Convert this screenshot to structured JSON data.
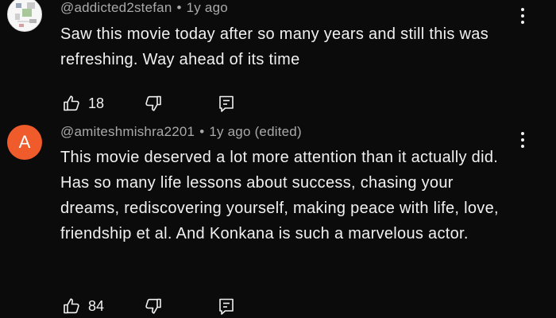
{
  "comments": [
    {
      "author": "@addicted2stefan",
      "time": "1y ago",
      "edited": "",
      "avatar_letter": "",
      "avatar_color": "#f6f6f6",
      "text": "Saw this movie today after so many years and still this was refreshing. Way ahead of its time",
      "likes": "18"
    },
    {
      "author": "@amiteshmishra2201",
      "time": "1y ago",
      "edited": "(edited)",
      "avatar_letter": "A",
      "avatar_color": "#ef5b2b",
      "text": "This movie deserved a lot more attention than it actually did. Has so many life lessons about success, chasing your dreams, rediscovering yourself, making peace with life, love, friendship et al. And Konkana is such a marvelous actor.",
      "likes": "84"
    }
  ],
  "separator": "•",
  "icons": {
    "like": "thumbs-up-icon",
    "dislike": "thumbs-down-icon",
    "reply": "reply-comment-icon",
    "menu": "more-vertical-icon"
  }
}
